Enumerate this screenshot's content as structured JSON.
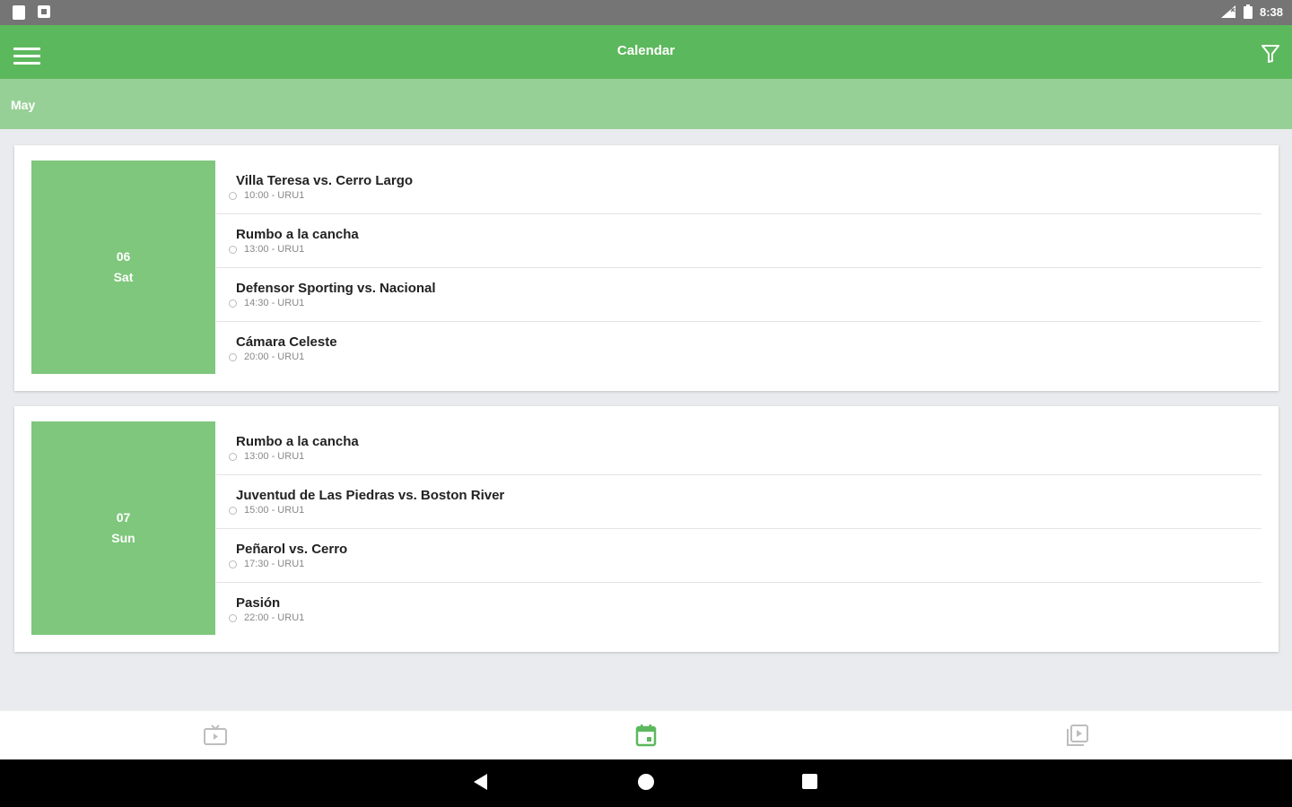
{
  "status_bar": {
    "time": "8:38"
  },
  "app_bar": {
    "title": "Calendar"
  },
  "month": "May",
  "days": [
    {
      "day_number": "06",
      "day_name": "Sat",
      "events": [
        {
          "title": "Villa Teresa vs. Cerro Largo",
          "meta": "10:00 - URU1"
        },
        {
          "title": "Rumbo a la cancha",
          "meta": "13:00 - URU1"
        },
        {
          "title": "Defensor Sporting vs. Nacional",
          "meta": "14:30 - URU1"
        },
        {
          "title": "Cámara Celeste",
          "meta": "20:00 - URU1"
        }
      ]
    },
    {
      "day_number": "07",
      "day_name": "Sun",
      "events": [
        {
          "title": "Rumbo a la cancha",
          "meta": "13:00 - URU1"
        },
        {
          "title": "Juventud de Las Piedras vs. Boston River",
          "meta": "15:00 - URU1"
        },
        {
          "title": "Peñarol vs. Cerro",
          "meta": "17:30 - URU1"
        },
        {
          "title": "Pasión",
          "meta": "22:00 - URU1"
        }
      ]
    }
  ],
  "bottom_nav": [
    {
      "icon": "live-tv-icon",
      "active": false
    },
    {
      "icon": "calendar-icon",
      "active": true
    },
    {
      "icon": "library-icon",
      "active": false
    }
  ],
  "colors": {
    "primary": "#5cb85c",
    "month_bar": "#97d096",
    "day_badge": "#7ec77c"
  }
}
